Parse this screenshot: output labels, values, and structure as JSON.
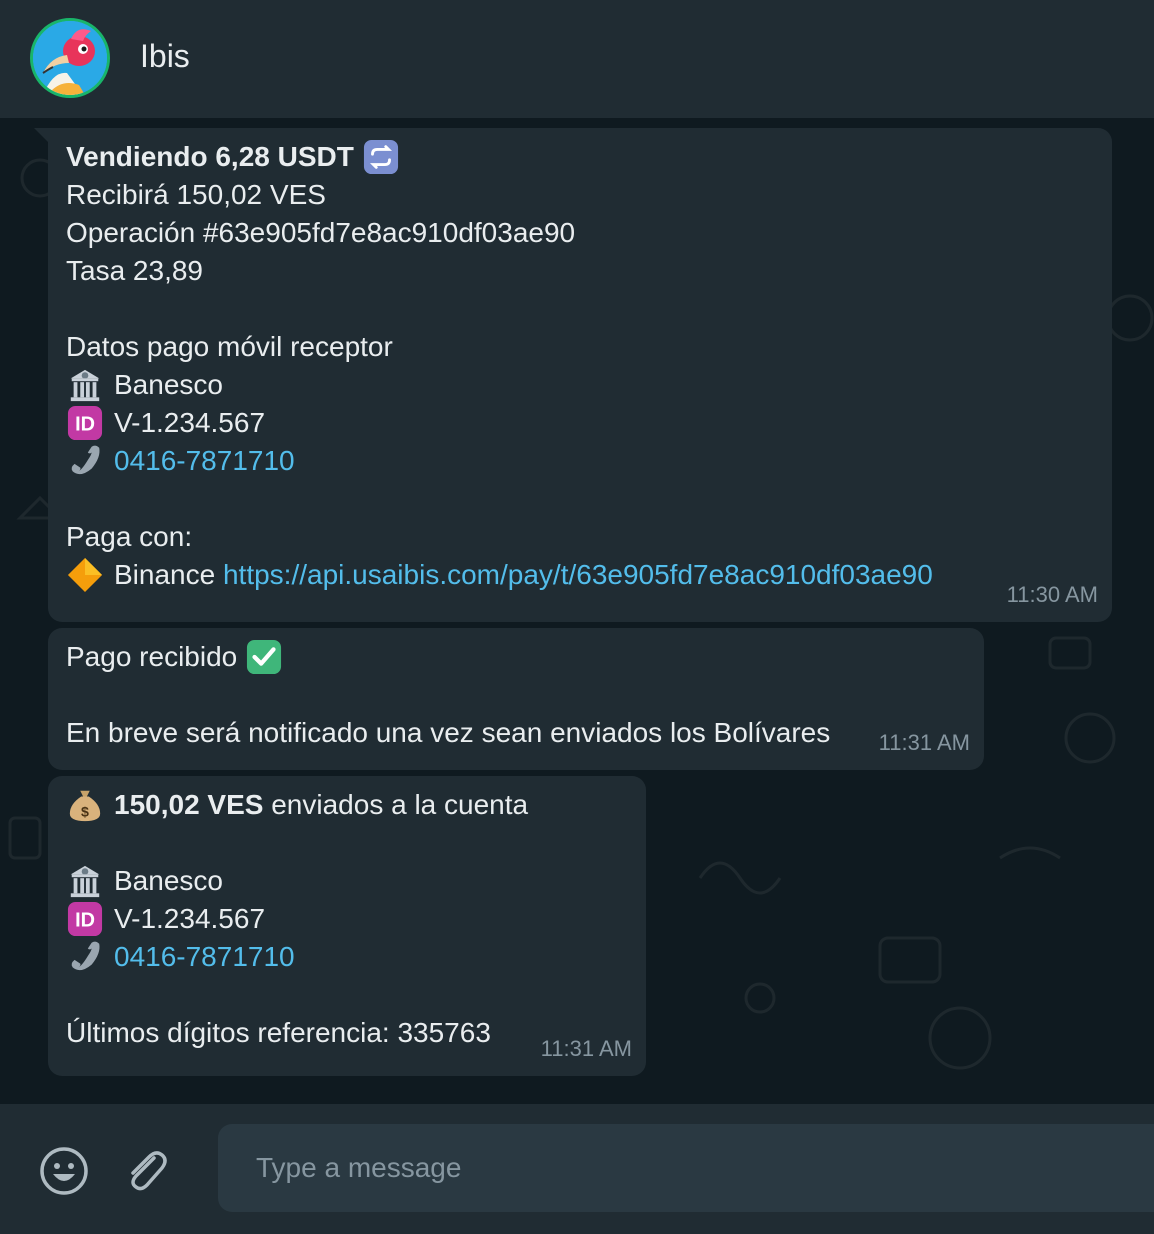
{
  "header": {
    "title": "Ibis",
    "avatar_icon": "ibis-bird-avatar"
  },
  "messages": [
    {
      "lines": {
        "title": "Vendiendo 6,28 USDT",
        "receive": "Recibirá 150,02 VES",
        "operation": "Operación #63e905fd7e8ac910df03ae90",
        "rate": "Tasa 23,89",
        "section": "Datos pago móvil receptor",
        "bank": "Banesco",
        "id": "V-1.234.567",
        "phone": "0416-7871710",
        "pay_with": "Paga con:",
        "pay_method": "Binance",
        "pay_link": "https://api.usaibis.com/pay/t/63e905fd7e8ac910df03ae90"
      },
      "time": "11:30 AM"
    },
    {
      "lines": {
        "title": "Pago recibido",
        "body": "En breve será notificado una vez sean enviados los Bolívares"
      },
      "time": "11:31 AM"
    },
    {
      "lines": {
        "amount": "150,02 VES",
        "amount_suffix": " enviados a la cuenta",
        "bank": "Banesco",
        "id": "V-1.234.567",
        "phone": "0416-7871710",
        "reference": "Últimos dígitos referencia: 335763"
      },
      "time": "11:31 AM"
    }
  ],
  "composer": {
    "placeholder": "Type a message",
    "emoji_icon": "emoji-icon",
    "attach_icon": "paperclip-icon"
  },
  "colors": {
    "bubble": "#202c33",
    "link": "#53bdeb",
    "text": "#e9edef",
    "muted": "#8696a0"
  }
}
